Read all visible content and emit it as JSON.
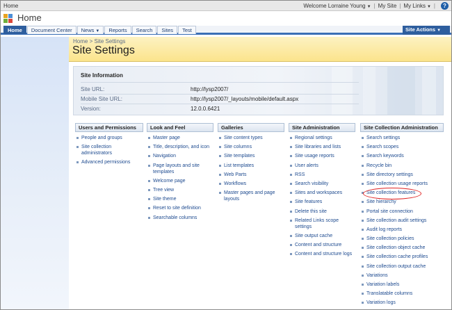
{
  "globalbar": {
    "breadcrumb": "Home",
    "welcome": "Welcome Lorraine Young",
    "my_site": "My Site",
    "my_links": "My Links"
  },
  "title_area": {
    "site_title": "Home"
  },
  "tabs": [
    "Home",
    "Document Center",
    "News",
    "Reports",
    "Search",
    "Sites",
    "Test"
  ],
  "site_actions": "Site Actions",
  "page_header": {
    "breadcrumb_root": "Home",
    "breadcrumb_sep": ">",
    "breadcrumb_current": "Site Settings",
    "title": "Site Settings"
  },
  "site_info": {
    "heading": "Site Information",
    "rows": [
      {
        "label": "Site URL:",
        "value": "http://lysp2007/"
      },
      {
        "label": "Mobile Site URL:",
        "value": "http://lysp2007/_layouts/mobile/default.aspx"
      },
      {
        "label": "Version:",
        "value": "12.0.0.6421"
      }
    ]
  },
  "columns": [
    {
      "heading": "Users and Permissions",
      "links": [
        "People and groups",
        "Site collection administrators",
        "Advanced permissions"
      ]
    },
    {
      "heading": "Look and Feel",
      "links": [
        "Master page",
        "Title, description, and icon",
        "Navigation",
        "Page layouts and site templates",
        "Welcome page",
        "Tree view",
        "Site theme",
        "Reset to site definition",
        "Searchable columns"
      ]
    },
    {
      "heading": "Galleries",
      "links": [
        "Site content types",
        "Site columns",
        "Site templates",
        "List templates",
        "Web Parts",
        "Workflows",
        "Master pages and page layouts"
      ]
    },
    {
      "heading": "Site Administration",
      "links": [
        "Regional settings",
        "Site libraries and lists",
        "Site usage reports",
        "User alerts",
        "RSS",
        "Search visibility",
        "Sites and workspaces",
        "Site features",
        "Delete this site",
        "Related Links scope settings",
        "Site output cache",
        "Content and structure",
        "Content and structure logs"
      ]
    },
    {
      "heading": "Site Collection Administration",
      "links": [
        "Search settings",
        "Search scopes",
        "Search keywords",
        "Recycle bin",
        "Site directory settings",
        "Site collection usage reports",
        "Site collection features",
        "Site hierarchy",
        "Portal site connection",
        "Site collection audit settings",
        "Audit log reports",
        "Site collection policies",
        "Site collection object cache",
        "Site collection cache profiles",
        "Site collection output cache",
        "Variations",
        "Variation labels",
        "Translatable columns",
        "Variation logs"
      ]
    }
  ],
  "colors": {
    "accent_blue": "#2e5e9e",
    "link_blue": "#1d4a8f",
    "header_yellow": "#fbe48c",
    "highlight_red": "#e02424"
  }
}
